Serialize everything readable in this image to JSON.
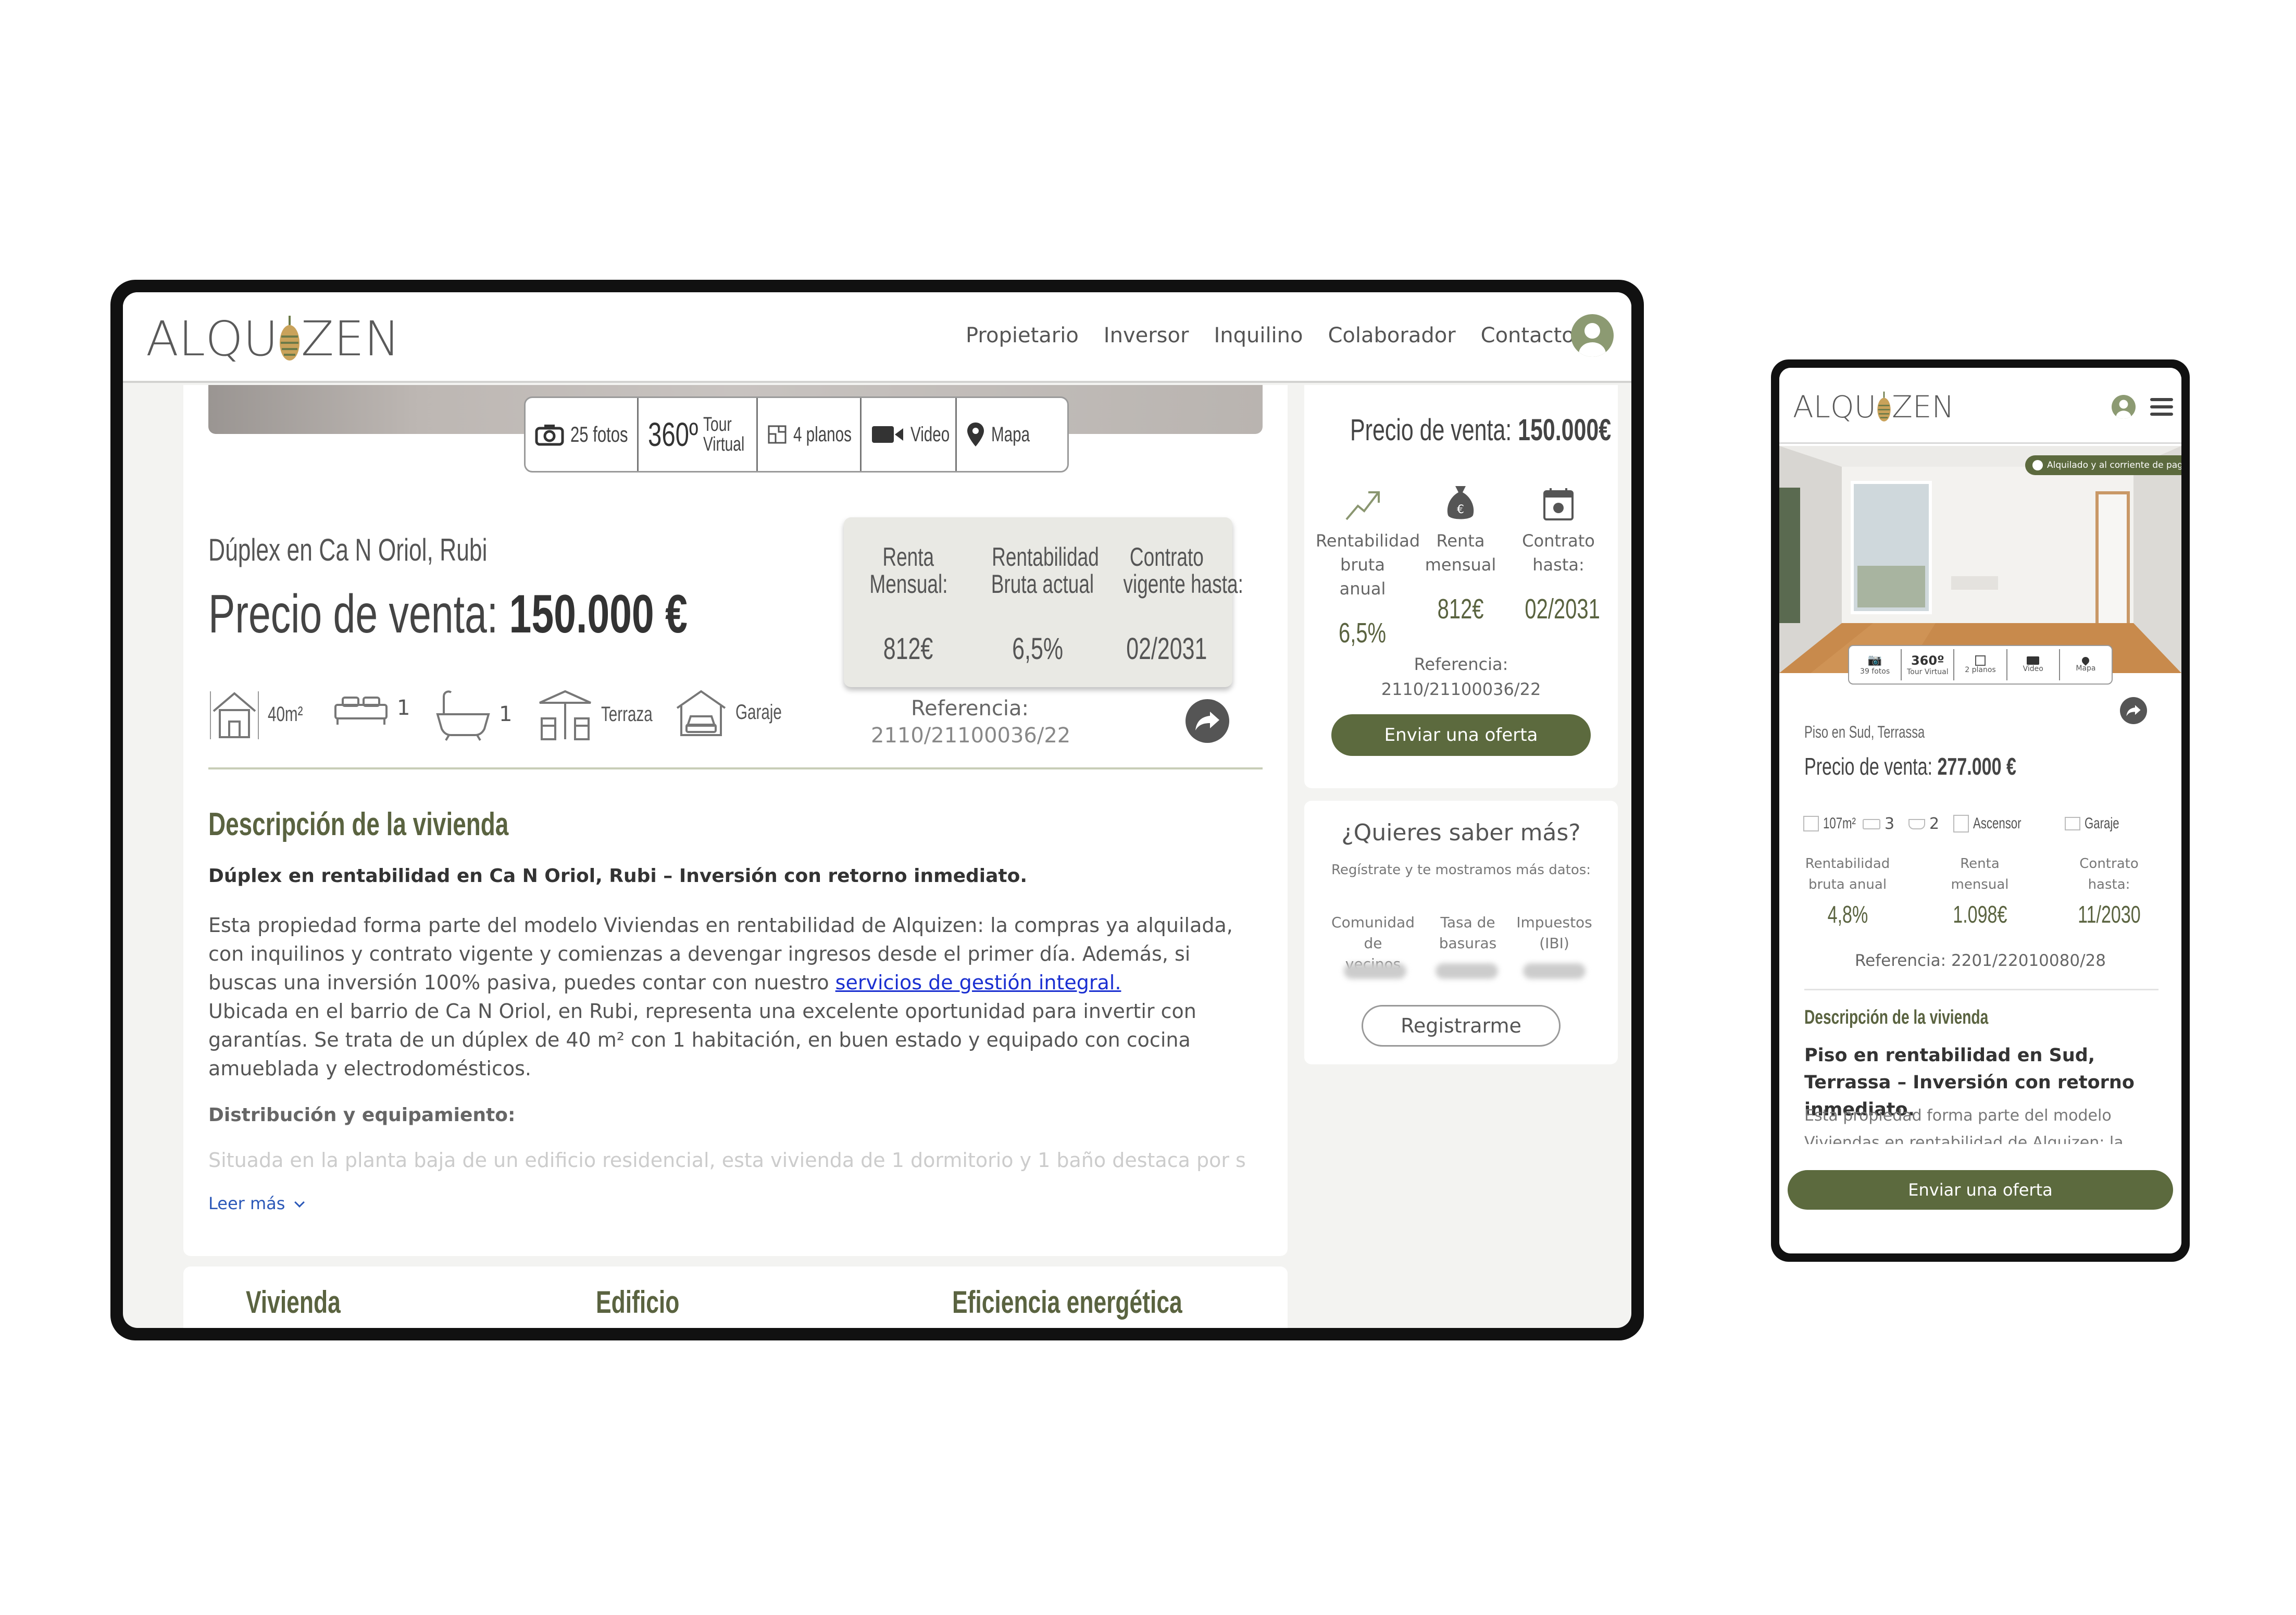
{
  "desktop": {
    "logo_left": "ALQU",
    "logo_right": "ZEN",
    "nav": [
      "Propietario",
      "Inversor",
      "Inquilino",
      "Colaborador",
      "Contacto"
    ],
    "media": {
      "fotos": "25 fotos",
      "deg": "360º",
      "tour1": "Tour",
      "tour2": "Virtual",
      "planos": "4 planos",
      "video": "Video",
      "mapa": "Mapa"
    },
    "subtitle": "Dúplex en Ca N Oriol, Rubi",
    "price_label": "Precio de venta:",
    "price_value": "150.000 €",
    "stats": [
      {
        "l1": "Renta",
        "l2": "Mensual:",
        "value": "812€"
      },
      {
        "l1": "Rentabilidad",
        "l2": "Bruta actual",
        "value": "6,5%"
      },
      {
        "l1": "Contrato",
        "l2": "vigente hasta:",
        "value": "02/2031"
      }
    ],
    "features": {
      "area": "40m²",
      "beds": "1",
      "baths": "1",
      "terrace": "Terraza",
      "garage": "Garaje"
    },
    "ref_label": "Referencia:",
    "ref_value": "2110/21100036/22",
    "desc_title": "Descripción de la vivienda",
    "desc_bold": "Dúplex en rentabilidad en Ca N Oriol, Rubi – Inversión con retorno inmediato.",
    "desc_p1": "Esta propiedad forma parte del modelo Viviendas en rentabilidad de Alquizen: la compras ya alquilada, con inquilinos y contrato vigente y comienzas a devengar ingresos desde el primer día. Además, si buscas una inversión 100% pasiva, puedes contar con nuestro ",
    "desc_link": "servicios de gestión integral.",
    "desc_p2": "Ubicada en el barrio de Ca N Oriol, en Rubi, representa una excelente oportunidad para invertir con garantías. Se trata de un dúplex de 40 m² con 1 habitación, en buen estado y equipado con cocina amueblada y electrodomésticos.",
    "dist_title": "Distribución y equipamiento:",
    "desc_fade": "Situada en la planta baja de un edificio residencial, esta vivienda de 1 dormitorio y 1 baño destaca por su",
    "read_more": "Leer más",
    "tabs": [
      "Vivienda",
      "Edificio",
      "Eficiencia energética"
    ],
    "side": {
      "price_label": "Precio de venta:",
      "price_value": "150.000€",
      "stats": [
        {
          "l1": "Rentabilidad",
          "l2": "bruta anual",
          "value": "6,5%"
        },
        {
          "l1": "Renta",
          "l2": "mensual",
          "value": "812€"
        },
        {
          "l1": "Contrato",
          "l2": "hasta:",
          "value": "02/2031"
        }
      ],
      "ref_label": "Referencia:",
      "ref_value": "2110/21100036/22",
      "offer_btn": "Enviar una oferta"
    },
    "more": {
      "title": "¿Quieres saber más?",
      "subtitle": "Regístrate y te mostramos más datos:",
      "cols": [
        {
          "l1": "Comunidad de",
          "l2": "vecinos"
        },
        {
          "l1": "Tasa de",
          "l2": "basuras"
        },
        {
          "l1": "Impuestos",
          "l2": "(IBI)"
        }
      ],
      "register_btn": "Registrarme"
    }
  },
  "mobile": {
    "logo_left": "ALQU",
    "logo_right": "ZEN",
    "badge": "Alquilado y al corriente de pago",
    "media": {
      "fotos": "39 fotos",
      "deg": "360º",
      "tour": "Tour Virtual",
      "planos": "2 planos",
      "video": "Video",
      "mapa": "Mapa"
    },
    "subtitle": "Piso en Sud, Terrassa",
    "price_label": "Precio de venta:",
    "price_value": "277.000 €",
    "features": {
      "area": "107m²",
      "beds": "3",
      "baths": "2",
      "lift": "Ascensor",
      "garage": "Garaje"
    },
    "stats": [
      {
        "l1": "Rentabilidad",
        "l2": "bruta anual",
        "value": "4,8%"
      },
      {
        "l1": "Renta",
        "l2": "mensual",
        "value": "1.098€"
      },
      {
        "l1": "Contrato",
        "l2": "hasta:",
        "value": "11/2030"
      }
    ],
    "ref": "Referencia: 2201/22010080/28",
    "desc_title": "Descripción de la vivienda",
    "desc_bold": "Piso en rentabilidad en Sud, Terrassa – Inversión con retorno inmediato.",
    "desc_p1": "Esta propiedad forma parte del modelo Viviendas en rentabilidad de Alquizen: la",
    "offer_btn": "Enviar una oferta"
  },
  "colors": {
    "olive": "#5c6a3e",
    "olive_text": "#5a6340",
    "link": "#1a2fd1"
  }
}
